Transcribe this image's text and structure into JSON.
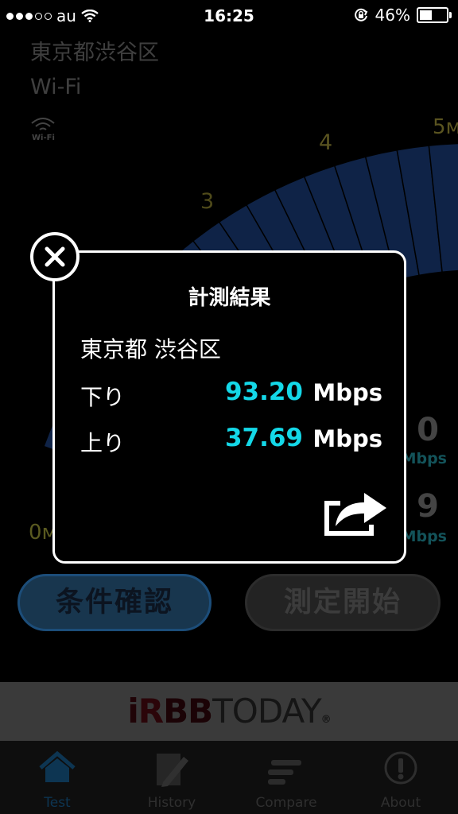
{
  "status_bar": {
    "signal_dots_filled": 3,
    "signal_dots_total": 5,
    "carrier": "au",
    "time": "16:25",
    "battery_percent": "46%",
    "battery_level": 0.46
  },
  "background": {
    "location": "東京都渋谷区",
    "network": "Wi-Fi",
    "wifi_icon_label": "Wi-Fi",
    "gauge_labels": [
      "3",
      "4",
      "5м"
    ],
    "gauge_min_label": "0м",
    "download_value": "0",
    "download_unit": "Mbps",
    "upload_value": "9",
    "upload_unit": "Mbps",
    "condition_button": "条件確認",
    "start_button": "測定開始"
  },
  "banner": {
    "logo_i": "i",
    "logo_r": "R",
    "logo_bb": "BB",
    "logo_today": "TODAY",
    "logo_reg": "®"
  },
  "tabs": [
    {
      "label": "Test",
      "icon": "home-icon",
      "active": true
    },
    {
      "label": "History",
      "icon": "history-icon",
      "active": false
    },
    {
      "label": "Compare",
      "icon": "compare-icon",
      "active": false
    },
    {
      "label": "About",
      "icon": "info-icon",
      "active": false
    }
  ],
  "dialog": {
    "title": "計測結果",
    "location": "東京都 渋谷区",
    "download_label": "下り",
    "download_value": "93.20",
    "download_unit": "Mbps",
    "upload_label": "上り",
    "upload_value": "37.69",
    "upload_unit": "Mbps",
    "close_icon": "close-icon",
    "share_icon": "share-icon"
  },
  "colors": {
    "accent_value": "#14d8e8",
    "gauge_blue": "#0f2347",
    "active_tab": "#0d3552"
  }
}
